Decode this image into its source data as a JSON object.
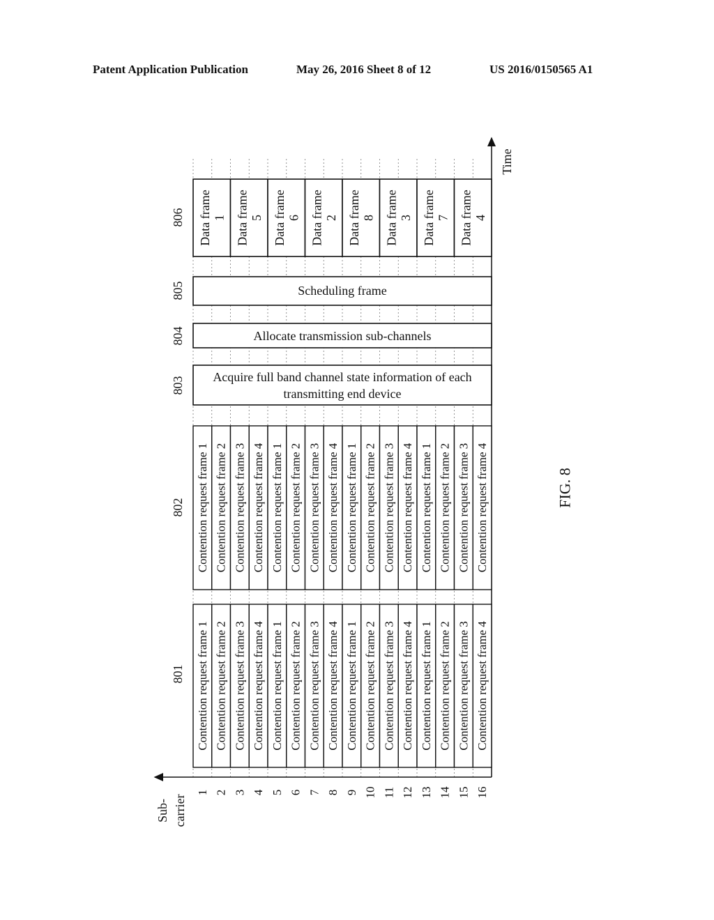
{
  "header": {
    "left": "Patent Application Publication",
    "date_sheet": "May 26, 2016   Sheet 8 of 12",
    "patent_number": "US 2016/0150565 A1"
  },
  "figure": {
    "caption": "FIG. 8",
    "axes": {
      "time_label": "Time",
      "subcarrier_label_line1": "Sub-",
      "subcarrier_label_line2": "carrier",
      "subcarriers": [
        "1",
        "2",
        "3",
        "4",
        "5",
        "6",
        "7",
        "8",
        "9",
        "10",
        "11",
        "12",
        "13",
        "14",
        "15",
        "16"
      ]
    },
    "blocks": {
      "b801": {
        "ref": "801",
        "cells": [
          "Contention request frame 1",
          "Contention request frame 2",
          "Contention request frame 3",
          "Contention request frame 4",
          "Contention request frame 1",
          "Contention request frame 2",
          "Contention request frame 3",
          "Contention request frame 4",
          "Contention request frame 1",
          "Contention request frame 2",
          "Contention request frame 3",
          "Contention request frame 4",
          "Contention request frame 1",
          "Contention request frame 2",
          "Contention request frame 3",
          "Contention request frame 4"
        ]
      },
      "b802": {
        "ref": "802",
        "cells": [
          "Contention request frame 1",
          "Contention request frame 2",
          "Contention request frame 3",
          "Contention request frame 4",
          "Contention request frame 1",
          "Contention request frame 2",
          "Contention request frame 3",
          "Contention request frame 4",
          "Contention request frame 1",
          "Contention request frame 2",
          "Contention request frame 3",
          "Contention request frame 4",
          "Contention request frame 1",
          "Contention request frame 2",
          "Contention request frame 3",
          "Contention request frame 4"
        ]
      },
      "b803": {
        "ref": "803",
        "line1": "Acquire full band channel state information of each",
        "line2": "transmitting end device"
      },
      "b804": {
        "ref": "804",
        "text": "Allocate transmission sub-channels"
      },
      "b805": {
        "ref": "805",
        "text": "Scheduling frame"
      },
      "b806": {
        "ref": "806",
        "label": "Data frame",
        "frame_numbers": [
          "1",
          "5",
          "6",
          "2",
          "8",
          "3",
          "7",
          "4"
        ]
      }
    }
  }
}
